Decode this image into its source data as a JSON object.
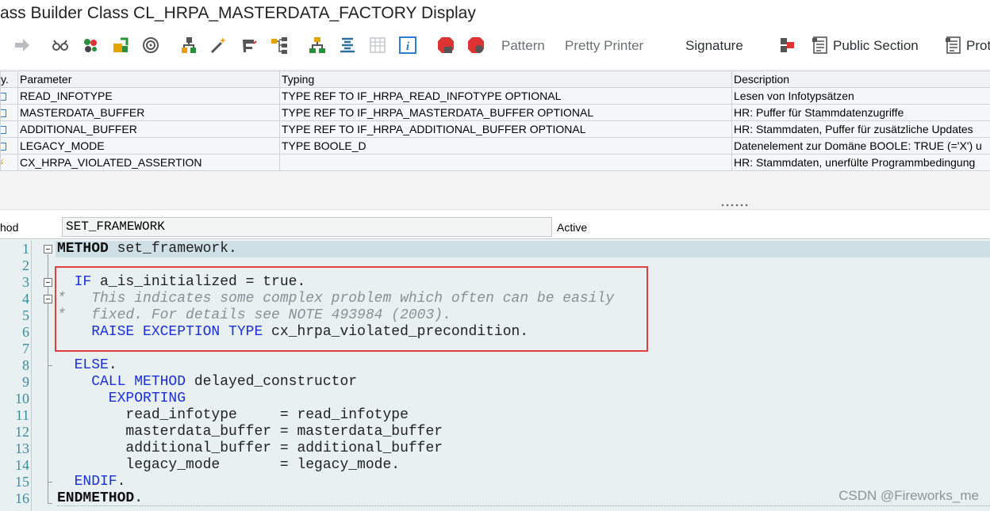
{
  "window": {
    "title": "ass Builder Class CL_HRPA_MASTERDATA_FACTORY Display"
  },
  "toolbar": {
    "icons": [
      "forward-arrow-icon",
      "glasses-icon",
      "object-list-icon",
      "activate-icon",
      "where-used-icon",
      "hierarchy-icon",
      "magic-wand-icon",
      "pretty-icon",
      "cascade-icon",
      "tree-icon",
      "list-icon",
      "grid-icon",
      "info-icon",
      "stop-icon",
      "breakpoint-icon"
    ],
    "pattern_label": "Pattern",
    "pretty_printer_label": "Pretty Printer",
    "signature_label": "Signature",
    "public_section_label": "Public Section",
    "protected_section_label": "Prot"
  },
  "params": {
    "headers": {
      "type": "y.",
      "parameter": "Parameter",
      "typing": "Typing",
      "description": "Description"
    },
    "rows": [
      {
        "kind": "importing",
        "name": "READ_INFOTYPE",
        "typing": "TYPE REF TO IF_HRPA_READ_INFOTYPE OPTIONAL",
        "description": "Lesen von Infotypsätzen"
      },
      {
        "kind": "importing",
        "name": "MASTERDATA_BUFFER",
        "typing": "TYPE REF TO IF_HRPA_MASTERDATA_BUFFER OPTIONAL",
        "description": "HR: Puffer für Stammdatenzugriffe"
      },
      {
        "kind": "importing",
        "name": "ADDITIONAL_BUFFER",
        "typing": "TYPE REF TO IF_HRPA_ADDITIONAL_BUFFER OPTIONAL",
        "description": "HR: Stammdaten, Puffer für zusätzliche Updates"
      },
      {
        "kind": "importing",
        "name": "LEGACY_MODE",
        "typing": "TYPE BOOLE_D",
        "description": "Datenelement zur Domäne BOOLE: TRUE (='X') u"
      },
      {
        "kind": "exception",
        "name": "CX_HRPA_VIOLATED_ASSERTION",
        "typing": "",
        "description": "HR: Stammdaten, unerfülte Programmbedingung"
      }
    ]
  },
  "method_bar": {
    "label": "hod",
    "method_name": "SET_FRAMEWORK",
    "status": "Active"
  },
  "editor": {
    "line_numbers": [
      "1",
      "2",
      "3",
      "4",
      "5",
      "6",
      "7",
      "8",
      "9",
      "10",
      "11",
      "12",
      "13",
      "14",
      "15",
      "16"
    ],
    "code": {
      "l1a": "METHOD",
      "l1b": " set_framework.",
      "l3a": "  IF",
      "l3b": " a_is_initialized = true.",
      "l4": "*   This indicates some complex problem which often can be easily",
      "l5": "*   fixed. For details see NOTE 493984 (2003).",
      "l6a": "    RAISE EXCEPTION TYPE",
      "l6b": " cx_hrpa_violated_precondition.",
      "l8a": "  ELSE",
      "l8b": ".",
      "l9a": "    CALL METHOD",
      "l9b": " delayed_constructor",
      "l10": "      EXPORTING",
      "l11": "        read_infotype     = read_infotype",
      "l12": "        masterdata_buffer = masterdata_buffer",
      "l13": "        additional_buffer = additional_buffer",
      "l14": "        legacy_mode       = legacy_mode.",
      "l15a": "  ENDIF",
      "l15b": ".",
      "l16a": "ENDMETHOD",
      "l16b": "."
    }
  },
  "watermark": "CSDN @Fireworks_me",
  "colors": {
    "keyword": "#1a2fd6",
    "comment": "#8a9096",
    "highlight_box": "#e0403f",
    "editor_bg": "#e8f0f2"
  }
}
